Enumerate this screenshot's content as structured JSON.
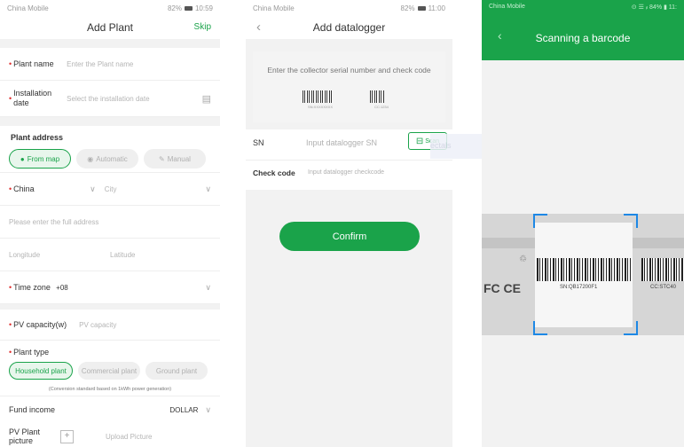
{
  "screen1": {
    "status": {
      "carrier": "China Mobile",
      "signal": "ᵢₗ ᯤ ◻",
      "battery": "82%",
      "time": "10:59"
    },
    "title": "Add Plant",
    "skip": "Skip",
    "plant_name": {
      "label": "Plant name",
      "placeholder": "Enter the Plant name"
    },
    "installation_date": {
      "label_line1": "Installation",
      "label_line2": "date",
      "placeholder": "Select the installation date"
    },
    "plant_address": {
      "label": "Plant address",
      "from_map": "From map",
      "automatic": "Automatic",
      "manual": "Manual"
    },
    "country": "China",
    "city": "City",
    "full_address_placeholder": "Please enter the full address",
    "longitude_placeholder": "Longitude",
    "latitude_placeholder": "Latitude",
    "time_zone": {
      "label": "Time zone",
      "value": "+08"
    },
    "pv_capacity": {
      "label": "PV capacity(w)",
      "placeholder": "PV capacity"
    },
    "plant_type": {
      "label": "Plant type",
      "household": "Household plant",
      "commercial": "Commercial plant",
      "ground": "Ground plant"
    },
    "conversion_note": "(Conversion standard based on 1kWh power generation)",
    "fund_income": {
      "label": "Fund income",
      "value": "DOLLAR"
    },
    "pv_picture": {
      "label_line1": "PV Plant",
      "label_line2": "picture",
      "upload": "Upload Picture"
    }
  },
  "screen2": {
    "status": {
      "carrier": "China Mobile",
      "signal": "ᵢₗ ᯤ ◻",
      "battery": "82%",
      "time": "11:00"
    },
    "title": "Add datalogger",
    "instruction": "Enter the collector serial number and check code",
    "barcode1_caption": "SN:XXXXXXXX",
    "barcode2_caption": "CC:1234",
    "sn_label": "SN",
    "sn_placeholder": "Input datalogger SN",
    "scan_label": "Scan",
    "check_code_label": "Check code",
    "check_code_placeholder": "Input datalogger checkcode",
    "confirm": "Confirm",
    "ghost_text": "ectals"
  },
  "screen3": {
    "status": {
      "carrier": "China Mobile",
      "right": "⊙ ☰ ᵢₗ 84% ▮ 11:",
      "battery": "84%"
    },
    "title": "Scanning a barcode",
    "sn_print": "SN:QB17200F1",
    "cc_print": "CC:STC40",
    "fcc_mark": "FC CE"
  },
  "colors": {
    "accent": "#1aa34a",
    "scan_corner": "#1e88e5",
    "required": "#e03131"
  }
}
